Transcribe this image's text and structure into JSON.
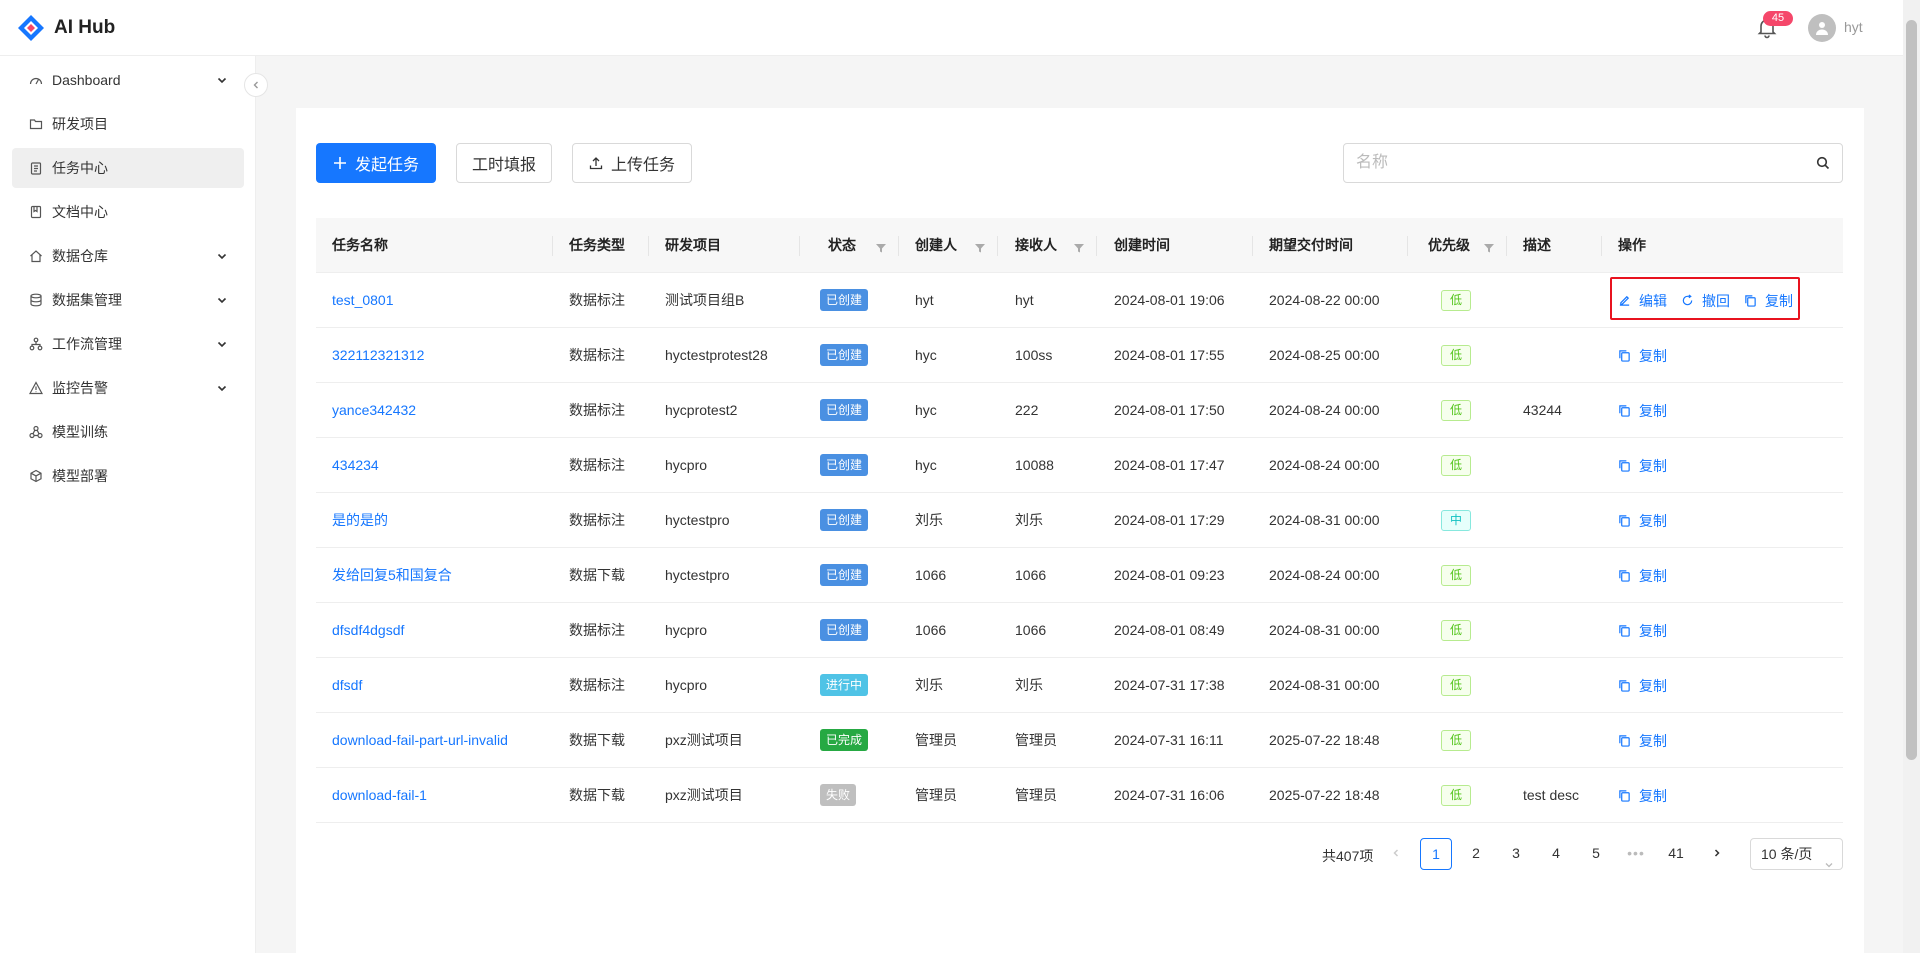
{
  "app": {
    "name": "AI Hub",
    "notification_count": "45",
    "username": "hyt"
  },
  "sidebar": {
    "items": [
      {
        "label": "Dashboard",
        "icon": "dashboard-icon",
        "has_children": true,
        "active": false
      },
      {
        "label": "研发项目",
        "icon": "folder-icon",
        "has_children": false,
        "active": false
      },
      {
        "label": "任务中心",
        "icon": "clipboard-icon",
        "has_children": false,
        "active": true
      },
      {
        "label": "文档中心",
        "icon": "book-icon",
        "has_children": false,
        "active": false
      },
      {
        "label": "数据仓库",
        "icon": "home-icon",
        "has_children": true,
        "active": false
      },
      {
        "label": "数据集管理",
        "icon": "database-icon",
        "has_children": true,
        "active": false
      },
      {
        "label": "工作流管理",
        "icon": "workflow-icon",
        "has_children": true,
        "active": false
      },
      {
        "label": "监控告警",
        "icon": "warning-icon",
        "has_children": true,
        "active": false
      },
      {
        "label": "模型训练",
        "icon": "cluster-icon",
        "has_children": false,
        "active": false
      },
      {
        "label": "模型部署",
        "icon": "cube-icon",
        "has_children": false,
        "active": false
      }
    ]
  },
  "toolbar": {
    "create_label": "发起任务",
    "timesheet_label": "工时填报",
    "upload_label": "上传任务",
    "search_placeholder": "名称"
  },
  "table": {
    "columns": [
      "任务名称",
      "任务类型",
      "研发项目",
      "状态",
      "创建人",
      "接收人",
      "创建时间",
      "期望交付时间",
      "优先级",
      "描述",
      "操作"
    ],
    "rows": [
      {
        "name": "test_0801",
        "type": "数据标注",
        "project": "测试项目组B",
        "status": "已创建",
        "creator": "hyt",
        "receiver": "hyt",
        "created": "2024-08-01 19:06",
        "due": "2024-08-22 00:00",
        "priority": "低",
        "desc": "",
        "ops": [
          "编辑",
          "撤回",
          "复制"
        ]
      },
      {
        "name": "322112321312",
        "type": "数据标注",
        "project": "hyctestprotest28",
        "status": "已创建",
        "creator": "hyc",
        "receiver": "100ss",
        "created": "2024-08-01 17:55",
        "due": "2024-08-25 00:00",
        "priority": "低",
        "desc": "",
        "ops": [
          "复制"
        ]
      },
      {
        "name": "yance342432",
        "type": "数据标注",
        "project": "hycprotest2",
        "status": "已创建",
        "creator": "hyc",
        "receiver": "222",
        "created": "2024-08-01 17:50",
        "due": "2024-08-24 00:00",
        "priority": "低",
        "desc": "43244",
        "ops": [
          "复制"
        ]
      },
      {
        "name": "434234",
        "type": "数据标注",
        "project": "hycpro",
        "status": "已创建",
        "creator": "hyc",
        "receiver": "10088",
        "created": "2024-08-01 17:47",
        "due": "2024-08-24 00:00",
        "priority": "低",
        "desc": "",
        "ops": [
          "复制"
        ]
      },
      {
        "name": "是的是的",
        "type": "数据标注",
        "project": "hyctestpro",
        "status": "已创建",
        "creator": "刘乐",
        "receiver": "刘乐",
        "created": "2024-08-01 17:29",
        "due": "2024-08-31 00:00",
        "priority": "中",
        "desc": "",
        "ops": [
          "复制"
        ]
      },
      {
        "name": "发给回复5和国复合",
        "type": "数据下载",
        "project": "hyctestpro",
        "status": "已创建",
        "creator": "1066",
        "receiver": "1066",
        "created": "2024-08-01 09:23",
        "due": "2024-08-24 00:00",
        "priority": "低",
        "desc": "",
        "ops": [
          "复制"
        ]
      },
      {
        "name": "dfsdf4dgsdf",
        "type": "数据标注",
        "project": "hycpro",
        "status": "已创建",
        "creator": "1066",
        "receiver": "1066",
        "created": "2024-08-01 08:49",
        "due": "2024-08-31 00:00",
        "priority": "低",
        "desc": "",
        "ops": [
          "复制"
        ]
      },
      {
        "name": "dfsdf",
        "type": "数据标注",
        "project": "hycpro",
        "status": "进行中",
        "creator": "刘乐",
        "receiver": "刘乐",
        "created": "2024-07-31 17:38",
        "due": "2024-08-31 00:00",
        "priority": "低",
        "desc": "",
        "ops": [
          "复制"
        ]
      },
      {
        "name": "download-fail-part-url-invalid",
        "type": "数据下载",
        "project": "pxz测试项目",
        "status": "已完成",
        "creator": "管理员",
        "receiver": "管理员",
        "created": "2024-07-31 16:11",
        "due": "2025-07-22 18:48",
        "priority": "低",
        "desc": "",
        "ops": [
          "复制"
        ]
      },
      {
        "name": "download-fail-1",
        "type": "数据下载",
        "project": "pxz测试项目",
        "status": "失败",
        "creator": "管理员",
        "receiver": "管理员",
        "created": "2024-07-31 16:06",
        "due": "2025-07-22 18:48",
        "priority": "低",
        "desc": "test desc",
        "ops": [
          "复制"
        ]
      }
    ]
  },
  "status_colors": {
    "已创建": "#4a90e2",
    "进行中": "#4fc3e6",
    "已完成": "#26a943",
    "失败": "#bfbfbf"
  },
  "priority_colors": {
    "低": {
      "fg": "#52c41a",
      "bg": "#f6ffed",
      "border": "#b7eb8f"
    },
    "中": {
      "fg": "#13c2c2",
      "bg": "#e6fffb",
      "border": "#87e8de"
    }
  },
  "pagination": {
    "total_label": "共407项",
    "pages": [
      "1",
      "2",
      "3",
      "4",
      "5",
      "•••",
      "41"
    ],
    "current": "1",
    "page_size_label": "10 条/页"
  }
}
